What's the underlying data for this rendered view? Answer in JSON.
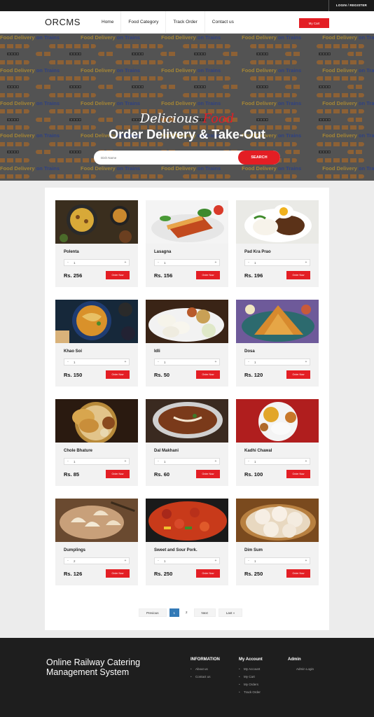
{
  "topbar": {
    "login_register": "LOGIN / REGISTER"
  },
  "header": {
    "logo": "ORCMS",
    "nav": [
      "Home",
      "Food Category",
      "Track Order",
      "Contact us"
    ],
    "cart_label": "My Cart"
  },
  "hero": {
    "pattern_text_a": "Food Delivery",
    "pattern_text_b": "on Trains",
    "script_word_1": "Delicious",
    "script_word_2": "Food",
    "title": "Order Delivery & Take-Out",
    "search_placeholder": "Dish Name",
    "search_button": "SEARCH"
  },
  "foods": [
    {
      "name": "Polenta",
      "price": "Rs. 256",
      "qty": "1",
      "img": "polenta"
    },
    {
      "name": "Lasagna",
      "price": "Rs. 156",
      "qty": "1",
      "img": "lasagna"
    },
    {
      "name": "Pad Kra Prao",
      "price": "Rs. 196",
      "qty": "1",
      "img": "padkrapao"
    },
    {
      "name": "Khao Soi",
      "price": "Rs. 150",
      "qty": "1",
      "img": "khaosoi"
    },
    {
      "name": "Idli",
      "price": "Rs. 50",
      "qty": "1",
      "img": "idli"
    },
    {
      "name": "Dosa",
      "price": "Rs. 120",
      "qty": "1",
      "img": "dosa"
    },
    {
      "name": "Chole Bhature",
      "price": "Rs. 85",
      "qty": "1",
      "img": "chole"
    },
    {
      "name": "Dal Makhani",
      "price": "Rs. 60",
      "qty": "1",
      "img": "dal"
    },
    {
      "name": "Kadhi Chawal",
      "price": "Rs. 100",
      "qty": "1",
      "img": "kadhi"
    },
    {
      "name": "Dumplings",
      "price": "Rs. 126",
      "qty": "2",
      "img": "dumplings"
    },
    {
      "name": "Sweet and Sour Pork.",
      "price": "Rs. 250",
      "qty": "1",
      "img": "pork"
    },
    {
      "name": "Dim Sum",
      "price": "Rs. 250",
      "qty": "1",
      "img": "dimsum"
    }
  ],
  "order_button": "Order Now",
  "qty_minus": "-",
  "qty_plus": "+",
  "pagination": {
    "previous": "Previous",
    "pages": [
      "1",
      "2"
    ],
    "active_page": "1",
    "next": "Next",
    "last": "Last »"
  },
  "footer": {
    "title": "Online Railway Catering Management System",
    "information": {
      "heading": "INFORMATION",
      "links": [
        "About us",
        "Contact us"
      ]
    },
    "account": {
      "heading": "My Account",
      "links": [
        "My Account",
        "My Cart",
        "My Orders",
        "Track Order"
      ]
    },
    "admin": {
      "heading": "Admin",
      "links": [
        "Admin Login"
      ]
    }
  },
  "colors": {
    "accent": "#e31e24",
    "page_active": "#337ab7",
    "footer_bg": "#1e1e1e"
  }
}
